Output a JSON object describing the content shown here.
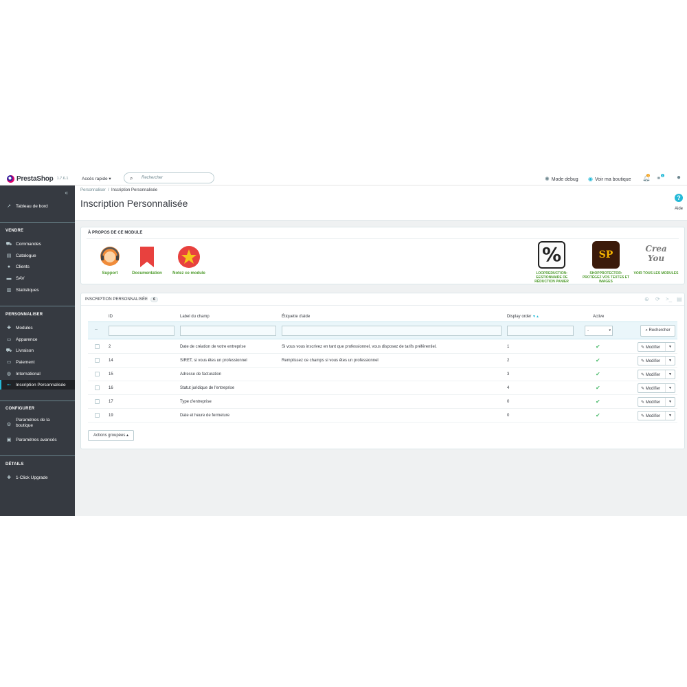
{
  "topbar": {
    "logo_text": "PrestaShop",
    "version": "1.7.6.1",
    "quick_access": "Accès rapide ▾",
    "search_placeholder": "Rechercher",
    "debug_mode": "Mode debug",
    "view_shop": "Voir ma boutique",
    "notif_count": "1",
    "cart_count": "1"
  },
  "sidebar": {
    "dashboard": "Tableau de bord",
    "sections": [
      {
        "title": "VENDRE",
        "items": [
          "Commandes",
          "Catalogue",
          "Clients",
          "SAV",
          "Statistiques"
        ]
      },
      {
        "title": "PERSONNALISER",
        "items": [
          "Modules",
          "Apparence",
          "Livraison",
          "Paiement",
          "International",
          "Inscription Personnalisée"
        ]
      },
      {
        "title": "CONFIGURER",
        "items": [
          "Paramètres de la boutique",
          "Paramètres avancés"
        ]
      },
      {
        "title": "DÉTAILS",
        "items": [
          "1-Click Upgrade"
        ]
      }
    ]
  },
  "header": {
    "breadcrumb_parent": "Personnaliser",
    "breadcrumb_sep": "/",
    "breadcrumb_current": "Inscription Personnalisée",
    "title": "Inscription Personnalisée",
    "help_label": "Aide"
  },
  "about": {
    "title": "À PROPOS DE CE MODULE",
    "links": [
      "Support",
      "Documentation",
      "Notez ce module"
    ],
    "modules": [
      {
        "name": "LOOPREDUCTION: GESTIONNAIRE DE RÉDUCTION PANIER",
        "icon_text": "%"
      },
      {
        "name": "SHOPPROTECTOR: PROTÉGEZ VOS TEXTES ET IMAGES",
        "icon_text": "SP"
      },
      {
        "name": "VOIR TOUS LES MODULES",
        "icon_text": "Crea You"
      }
    ]
  },
  "list": {
    "title": "INSCRIPTION PERSONNALISÉE",
    "count": "6",
    "columns": [
      "ID",
      "Label du champ",
      "Étiquette d'aide",
      "Display order",
      "Active"
    ],
    "filter_dash": "--",
    "filter_select": "-",
    "search_button": "Rechercher",
    "rows": [
      {
        "id": "2",
        "label": "Date de création de votre entreprise",
        "help": "Si vous vous inscrivez en tant que professionnel, vous disposez de tarifs préférentiel.",
        "order": "1"
      },
      {
        "id": "14",
        "label": "SIRET, si vous êtes un professionnel",
        "help": "Remplissez ce champs si vous êtes un professionnel",
        "order": "2"
      },
      {
        "id": "15",
        "label": "Adresse de facturation",
        "help": "",
        "order": "3"
      },
      {
        "id": "16",
        "label": "Statut juridique de l'entreprise",
        "help": "",
        "order": "4"
      },
      {
        "id": "17",
        "label": "Type d'entreprise",
        "help": "",
        "order": "0"
      },
      {
        "id": "19",
        "label": "Date et heure de fermeture",
        "help": "",
        "order": "0"
      }
    ],
    "edit_label": "Modifier",
    "bulk_actions": "Actions groupées ▴"
  },
  "colors": {
    "accent": "#25b9d7",
    "sidebar": "#363a41",
    "success": "#4cbb6c",
    "brand_pink": "#df0067"
  }
}
